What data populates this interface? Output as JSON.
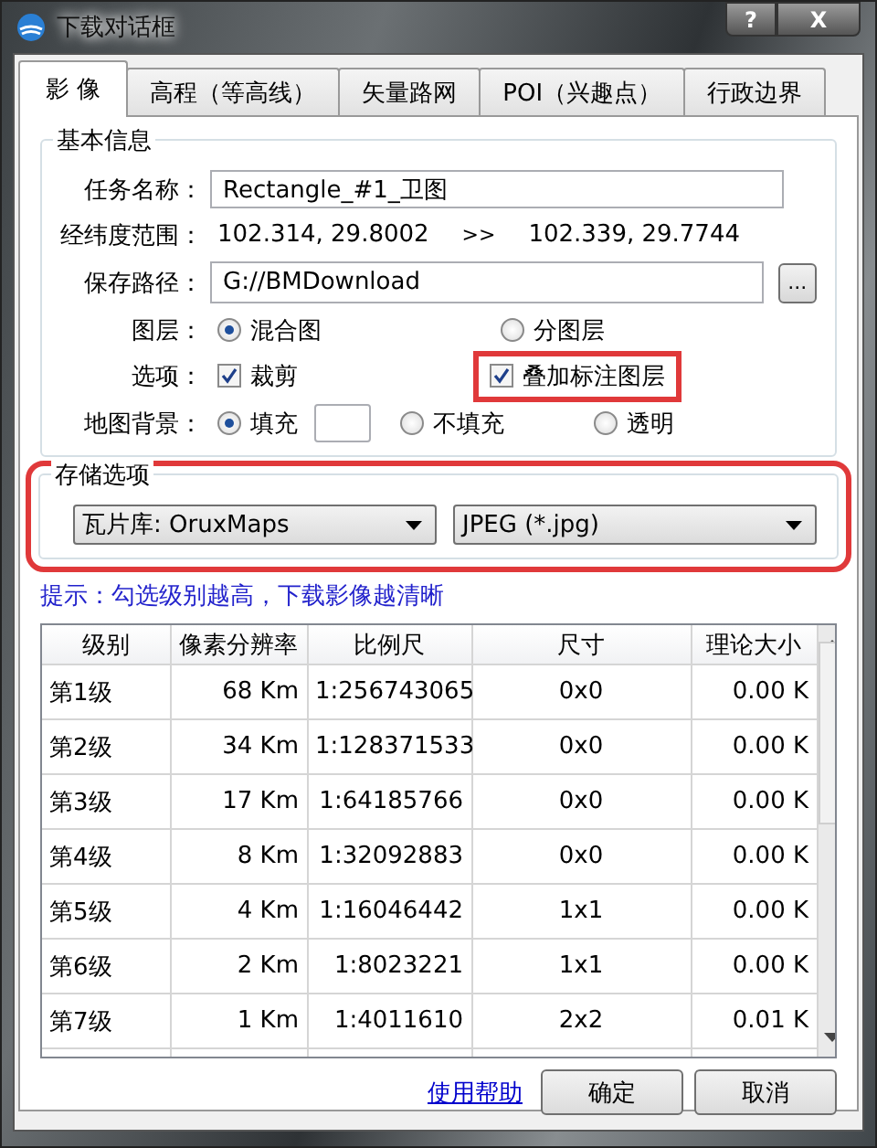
{
  "window": {
    "title": "下载对话框",
    "help_button": "?",
    "close_button": "X"
  },
  "tabs": [
    {
      "label": "影 像",
      "selected": true
    },
    {
      "label": "高程（等高线）",
      "selected": false
    },
    {
      "label": "矢量路网",
      "selected": false
    },
    {
      "label": "POI（兴趣点）",
      "selected": false
    },
    {
      "label": "行政边界",
      "selected": false
    }
  ],
  "basic_info": {
    "title": "基本信息",
    "task_name": {
      "label": "任务名称：",
      "value": "Rectangle_#1_卫图"
    },
    "range": {
      "label": "经纬度范围：",
      "from": "102.314, 29.8002",
      "separator": ">>",
      "to": "102.339, 29.7744"
    },
    "save_path": {
      "label": "保存路径：",
      "value": "G://BMDownload",
      "browse": "..."
    },
    "layers": {
      "label": "图层：",
      "options": [
        {
          "label": "混合图",
          "selected": true
        },
        {
          "label": "分图层",
          "selected": false
        }
      ]
    },
    "options": {
      "label": "选项：",
      "items": [
        {
          "label": "裁剪",
          "checked": true,
          "highlighted": false
        },
        {
          "label": "叠加标注图层",
          "checked": true,
          "highlighted": true
        }
      ]
    },
    "background": {
      "label": "地图背景：",
      "options": [
        {
          "label": "填充",
          "selected": true,
          "kind": "fill"
        },
        {
          "label": "不填充",
          "selected": false,
          "kind": "plain"
        },
        {
          "label": "透明",
          "selected": false,
          "kind": "plain"
        }
      ]
    }
  },
  "storage": {
    "title": "存储选项",
    "highlighted": true,
    "tile_store": "瓦片库: OruxMaps",
    "image_format": "JPEG (*.jpg)"
  },
  "hint": "提示：勾选级别越高，下载影像越清晰",
  "table": {
    "columns": [
      "级别",
      "像素分辨率",
      "比例尺",
      "尺寸",
      "理论大小"
    ],
    "rows": [
      [
        "第1级",
        "68 Km",
        "1:256743065",
        "0x0",
        "0.00 K"
      ],
      [
        "第2级",
        "34 Km",
        "1:128371533",
        "0x0",
        "0.00 K"
      ],
      [
        "第3级",
        "17 Km",
        "1:64185766",
        "0x0",
        "0.00 K"
      ],
      [
        "第4级",
        "8 Km",
        "1:32092883",
        "0x0",
        "0.00 K"
      ],
      [
        "第5级",
        "4 Km",
        "1:16046442",
        "1x1",
        "0.00 K"
      ],
      [
        "第6级",
        "2 Km",
        "1:8023221",
        "1x1",
        "0.00 K"
      ],
      [
        "第7级",
        "1 Km",
        "1:4011610",
        "2x2",
        "0.01 K"
      ]
    ]
  },
  "footer": {
    "help_link": "使用帮助",
    "buttons": [
      "确定",
      "取消"
    ]
  }
}
